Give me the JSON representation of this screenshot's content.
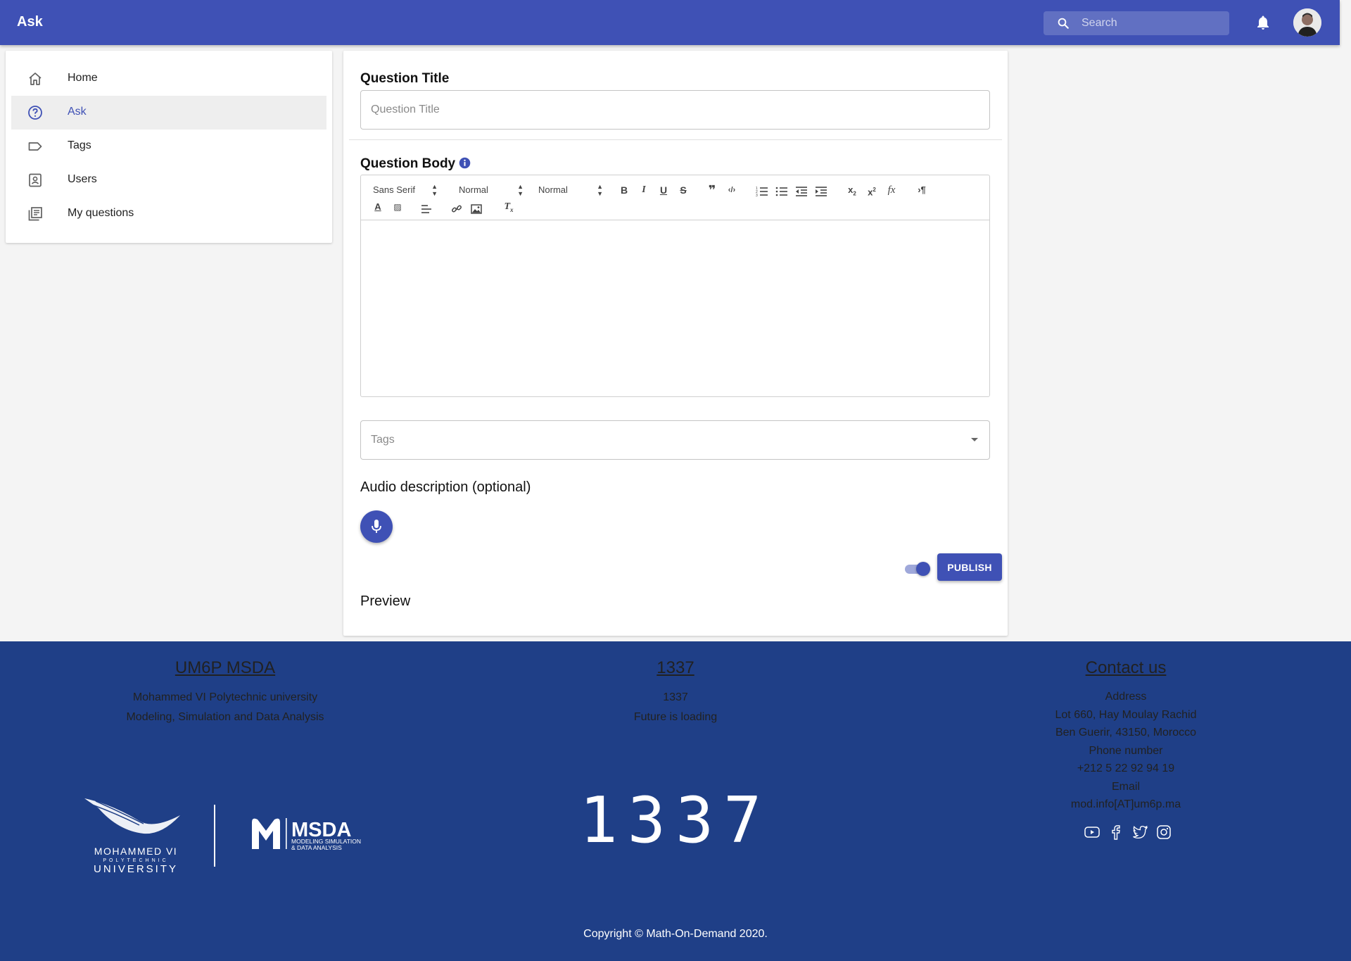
{
  "appbar": {
    "title": "Ask",
    "search_placeholder": "Search"
  },
  "sidebar": {
    "items": [
      {
        "label": "Home",
        "icon": "home-icon"
      },
      {
        "label": "Ask",
        "icon": "help-circle-icon",
        "active": true
      },
      {
        "label": "Tags",
        "icon": "label-icon"
      },
      {
        "label": "Users",
        "icon": "contact-card-icon"
      },
      {
        "label": "My questions",
        "icon": "library-books-icon"
      }
    ]
  },
  "form": {
    "title_label": "Question Title",
    "title_placeholder": "Question Title",
    "body_label": "Question Body",
    "editor": {
      "font_select": "Sans Serif",
      "size_select": "Normal",
      "header_select": "Normal"
    },
    "tags_placeholder": "Tags",
    "audio_label": "Audio description (optional)",
    "publish_label": "PUBLISH",
    "publish_toggle_on": true,
    "preview_label": "Preview"
  },
  "footer": {
    "col1": {
      "heading": "UM6P MSDA",
      "lines": [
        "Mohammed VI Polytechnic university",
        "Modeling, Simulation and Data Analysis"
      ]
    },
    "col2": {
      "heading": "1337",
      "lines": [
        "1337",
        "Future is loading"
      ]
    },
    "col3": {
      "heading": "Contact us",
      "lines": [
        "Address",
        "Lot 660, Hay Moulay Rachid",
        "Ben Guerir, 43150, Morocco",
        "Phone number",
        "+212 5 22 92 94 19",
        "Email",
        "mod.info[AT]um6p.ma"
      ]
    },
    "logos": {
      "um6p_line1": "MOHAMMED VI",
      "um6p_line2": "POLYTECHNIC",
      "um6p_line3": "UNIVERSITY",
      "msda_name": "MSDA",
      "msda_sub1": "MODELING SIMULATION",
      "msda_sub2": "& DATA ANALYSIS",
      "logo_1337": "1337"
    },
    "social_icons": [
      "youtube-icon",
      "facebook-icon",
      "twitter-icon",
      "instagram-icon"
    ],
    "copyright": "Copyright © Math-On-Demand 2020."
  },
  "colors": {
    "primary": "#3f51b5",
    "footer_bg": "#1f3f87"
  }
}
